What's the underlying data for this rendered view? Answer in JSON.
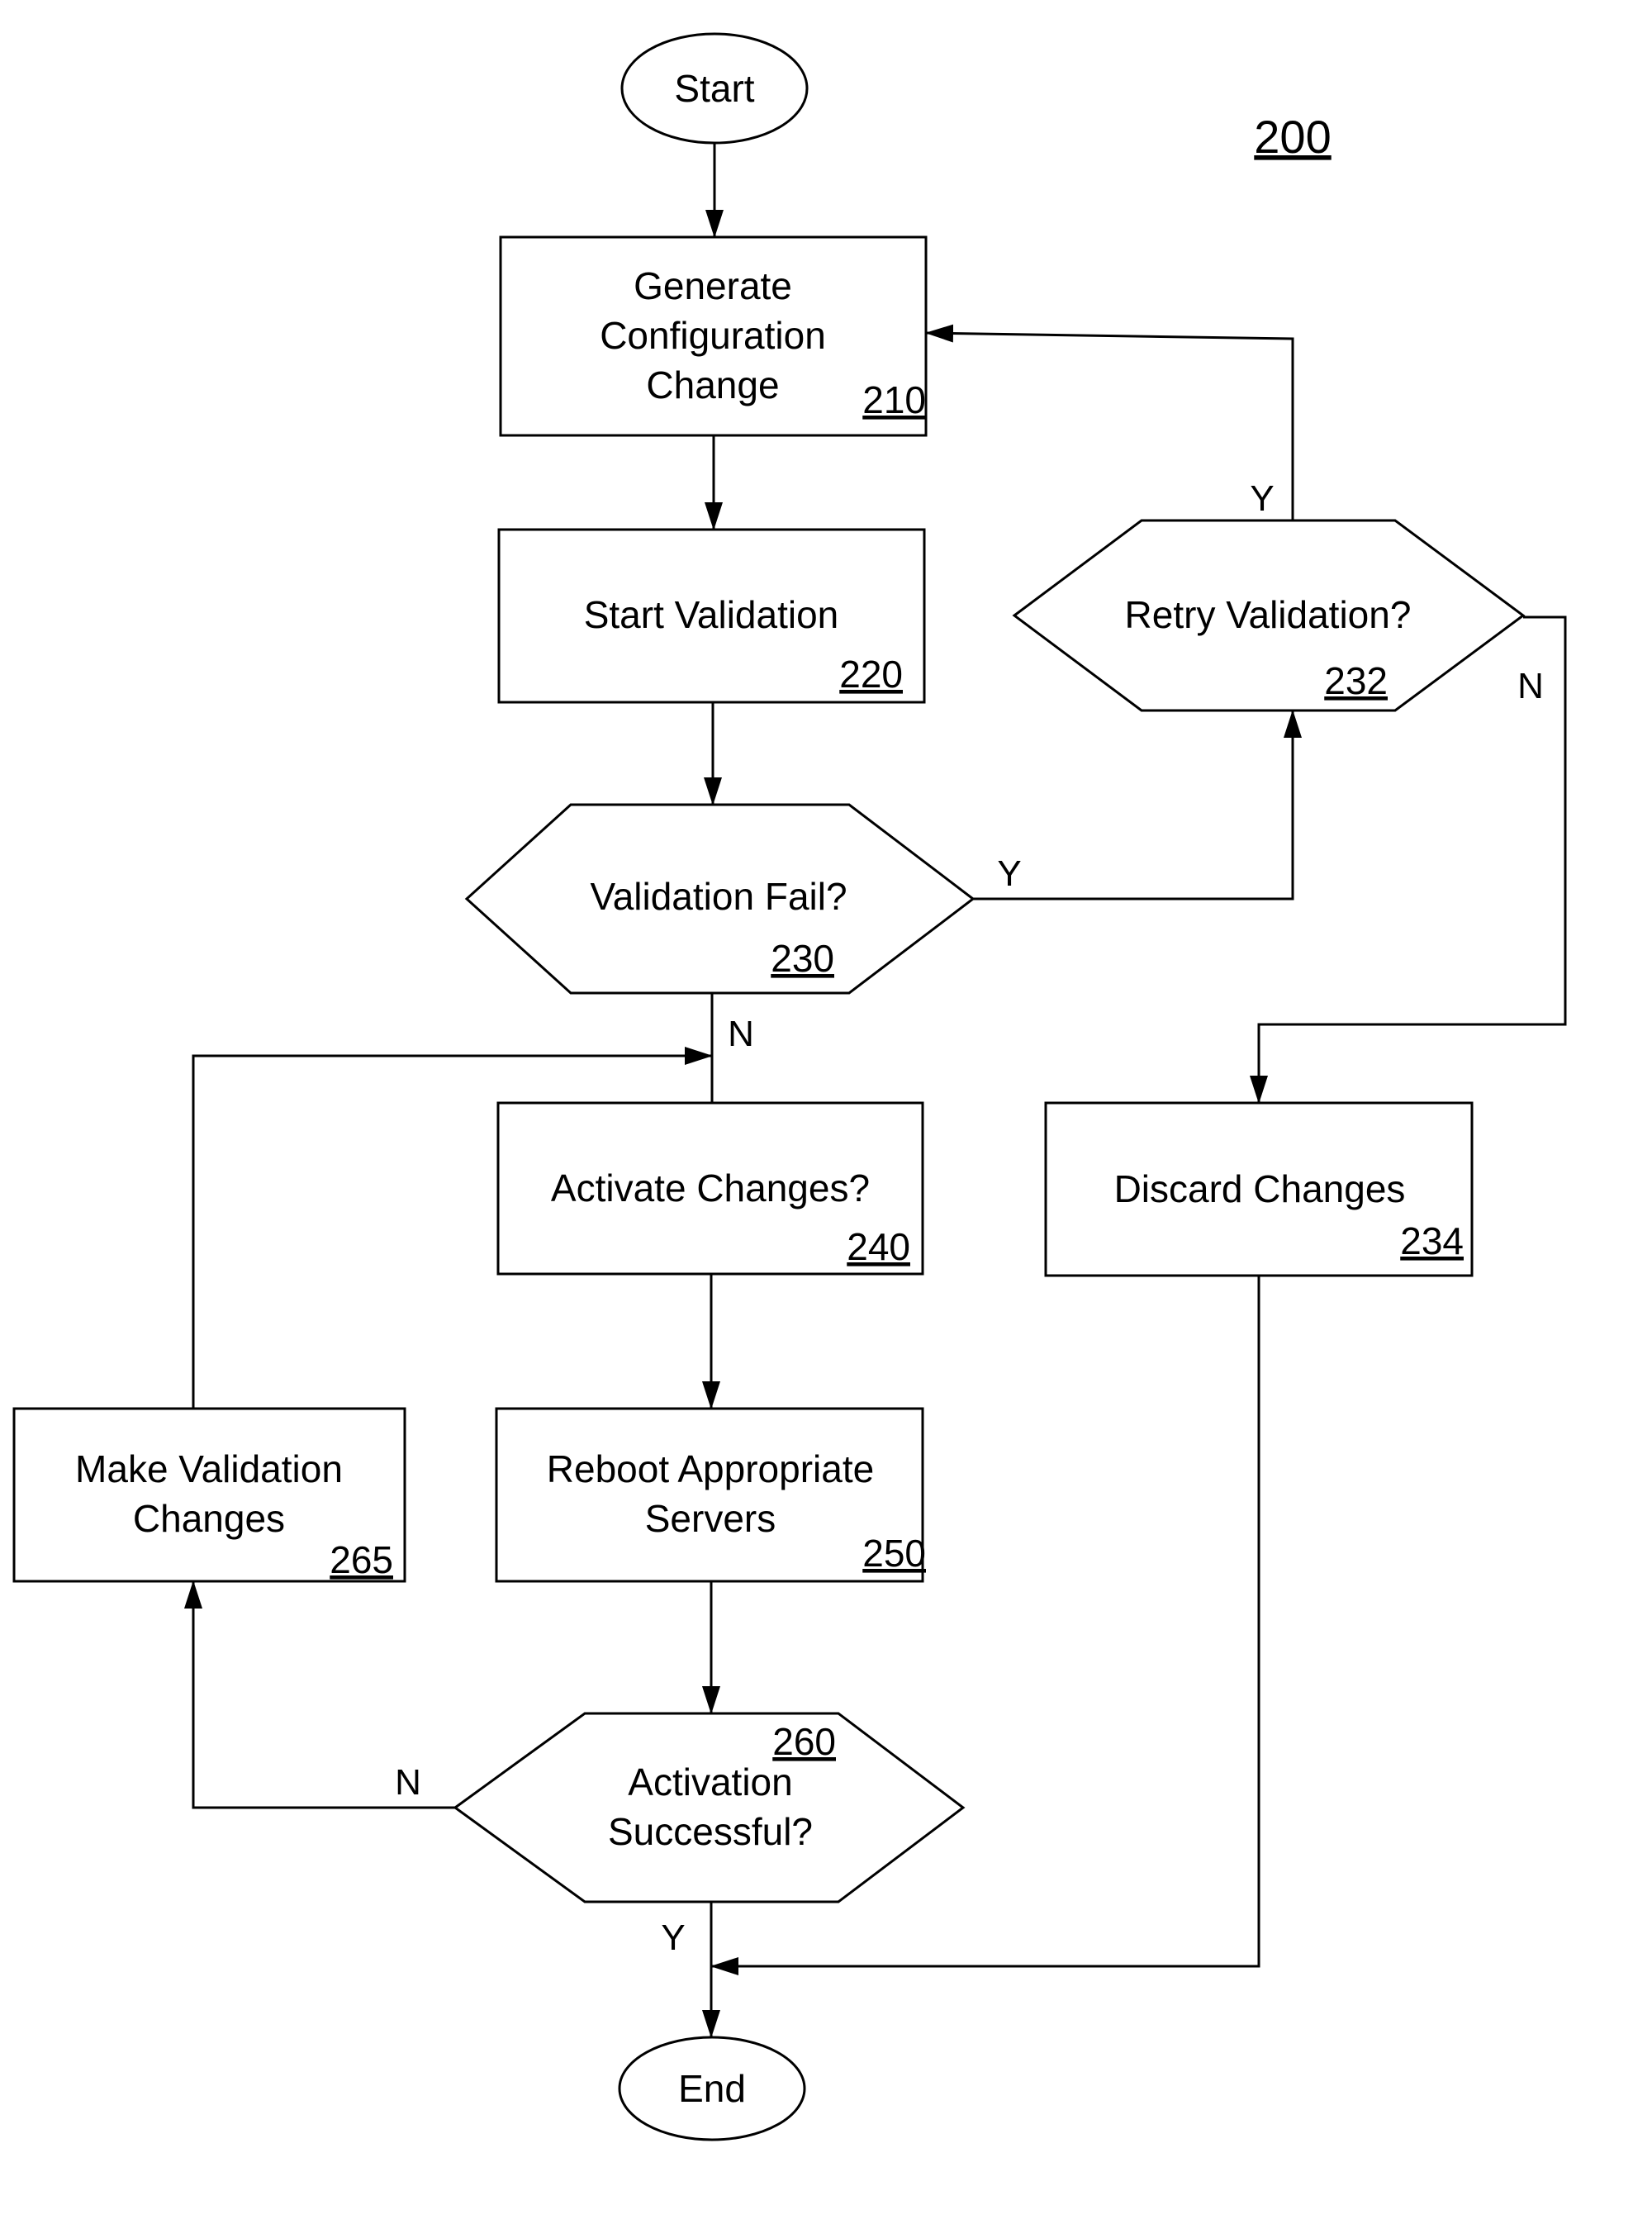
{
  "figure": {
    "number": "200"
  },
  "nodes": {
    "start": {
      "label": "Start"
    },
    "n210": {
      "lines": [
        "Generate",
        "Configuration",
        "Change"
      ],
      "ref": "210"
    },
    "n220": {
      "lines": [
        "Start Validation"
      ],
      "ref": "220"
    },
    "n230": {
      "lines": [
        "Validation Fail?"
      ],
      "ref": "230"
    },
    "n232": {
      "lines": [
        "Retry Validation?"
      ],
      "ref": "232"
    },
    "n234": {
      "lines": [
        "Discard Changes"
      ],
      "ref": "234"
    },
    "n240": {
      "lines": [
        "Activate Changes?"
      ],
      "ref": "240"
    },
    "n250": {
      "lines": [
        "Reboot Appropriate",
        "Servers"
      ],
      "ref": "250"
    },
    "n260": {
      "lines": [
        "Activation",
        "Successful?"
      ],
      "ref": "260"
    },
    "n265": {
      "lines": [
        "Make Validation",
        "Changes"
      ],
      "ref": "265"
    },
    "end": {
      "label": "End"
    }
  },
  "edge_labels": {
    "e230_yes": "Y",
    "e230_no": "N",
    "e232_yes": "Y",
    "e232_no": "N",
    "e260_yes": "Y",
    "e260_no": "N"
  }
}
